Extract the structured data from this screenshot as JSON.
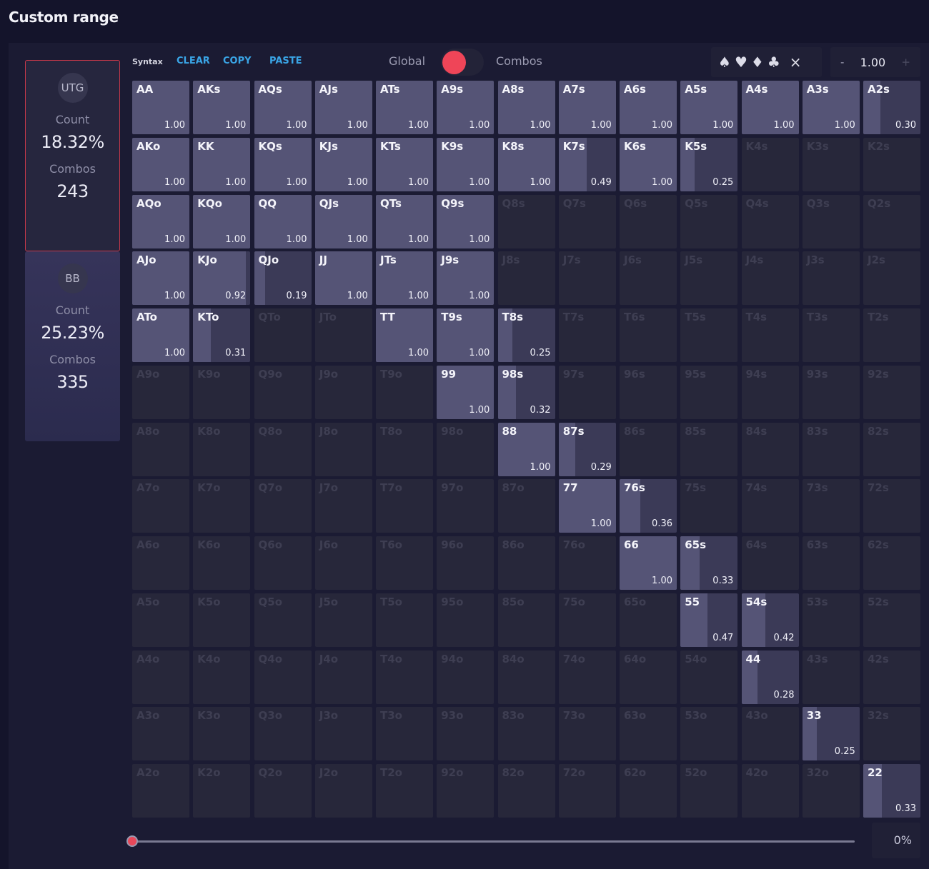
{
  "title": "Custom range",
  "positions": [
    {
      "name": "UTG",
      "count_label": "Count",
      "count": "18.32%",
      "combos_label": "Combos",
      "combos": "243"
    },
    {
      "name": "BB",
      "count_label": "Count",
      "count": "25.23%",
      "combos_label": "Combos",
      "combos": "335"
    }
  ],
  "toolbar": {
    "syntax": "Syntax",
    "clear": "CLEAR",
    "copy": "COPY",
    "paste": "PASTE",
    "toggle_left": "Global",
    "toggle_right": "Combos",
    "suits": [
      "spades-icon",
      "hearts-icon",
      "diamonds-icon",
      "clubs-icon"
    ],
    "close": "×",
    "minus": "-",
    "weight": "1.00",
    "plus": "+"
  },
  "grid": {
    "ranks": [
      "A",
      "K",
      "Q",
      "J",
      "T",
      "9",
      "8",
      "7",
      "6",
      "5",
      "4",
      "3",
      "2"
    ],
    "frequencies": {
      "AA": "1.00",
      "AKs": "1.00",
      "AQs": "1.00",
      "AJs": "1.00",
      "ATs": "1.00",
      "A9s": "1.00",
      "A8s": "1.00",
      "A7s": "1.00",
      "A6s": "1.00",
      "A5s": "1.00",
      "A4s": "1.00",
      "A3s": "1.00",
      "A2s": "0.30",
      "AKo": "1.00",
      "KK": "1.00",
      "KQs": "1.00",
      "KJs": "1.00",
      "KTs": "1.00",
      "K9s": "1.00",
      "K8s": "1.00",
      "K7s": "0.49",
      "K6s": "1.00",
      "K5s": "0.25",
      "AQo": "1.00",
      "KQo": "1.00",
      "QQ": "1.00",
      "QJs": "1.00",
      "QTs": "1.00",
      "Q9s": "1.00",
      "AJo": "1.00",
      "KJo": "0.92",
      "QJo": "0.19",
      "JJ": "1.00",
      "JTs": "1.00",
      "J9s": "1.00",
      "ATo": "1.00",
      "KTo": "0.31",
      "TT": "1.00",
      "T9s": "1.00",
      "T8s": "0.25",
      "99": "1.00",
      "98s": "0.32",
      "88": "1.00",
      "87s": "0.29",
      "77": "1.00",
      "76s": "0.36",
      "66": "1.00",
      "65s": "0.33",
      "55": "0.47",
      "54s": "0.42",
      "44": "0.28",
      "33": "0.25",
      "22": "0.33"
    }
  },
  "slider": {
    "value": 0,
    "label": "0%"
  },
  "colors": {
    "accent": "#ef4558",
    "link": "#3aa5e6",
    "cell_active": "#3b3a57",
    "cell_fill": "#555476",
    "cell_inactive": "#27273a"
  }
}
